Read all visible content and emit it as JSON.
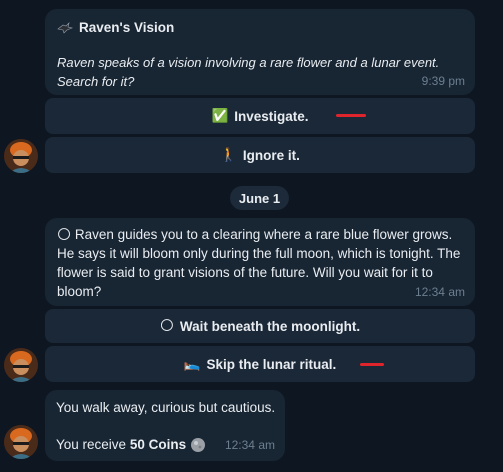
{
  "msg1": {
    "title_icon": "raven-icon",
    "title": "Raven's Vision",
    "body": "Raven speaks of a vision involving a rare flower and a lunar event. Search for it?",
    "time": "9:39 pm"
  },
  "buttons1": [
    {
      "icon": "check-emoji-icon",
      "emoji": "✅",
      "label": "Investigate."
    },
    {
      "icon": "walking-person-icon",
      "emoji": "🚶",
      "label": "Ignore it."
    }
  ],
  "date_separator": "June 1",
  "msg2": {
    "icon": "full-moon-emoji-icon",
    "emoji": "🌕",
    "body": "Raven guides you to a clearing where a rare blue flower grows. He says it will bloom only during the full moon, which is tonight. The flower is said to grant visions of the future. Will you wait for it to bloom?",
    "time": "12:34 am"
  },
  "buttons2": [
    {
      "icon": "full-moon-emoji-icon",
      "emoji": "🌕",
      "label": "Wait beneath the moonlight."
    },
    {
      "icon": "bed-emoji-icon",
      "emoji": "🛌",
      "label": "Skip the lunar ritual."
    }
  ],
  "msg3": {
    "line1": "You walk away, curious but cautious.",
    "line2_prefix": "You receive ",
    "coins": "50 Coins",
    "coin_icon": "coin-icon",
    "time": "12:34 am"
  },
  "colors": {
    "background": "#0e1621",
    "bubble": "#182533",
    "button": "#1b2837",
    "marker": "#e0242c"
  }
}
